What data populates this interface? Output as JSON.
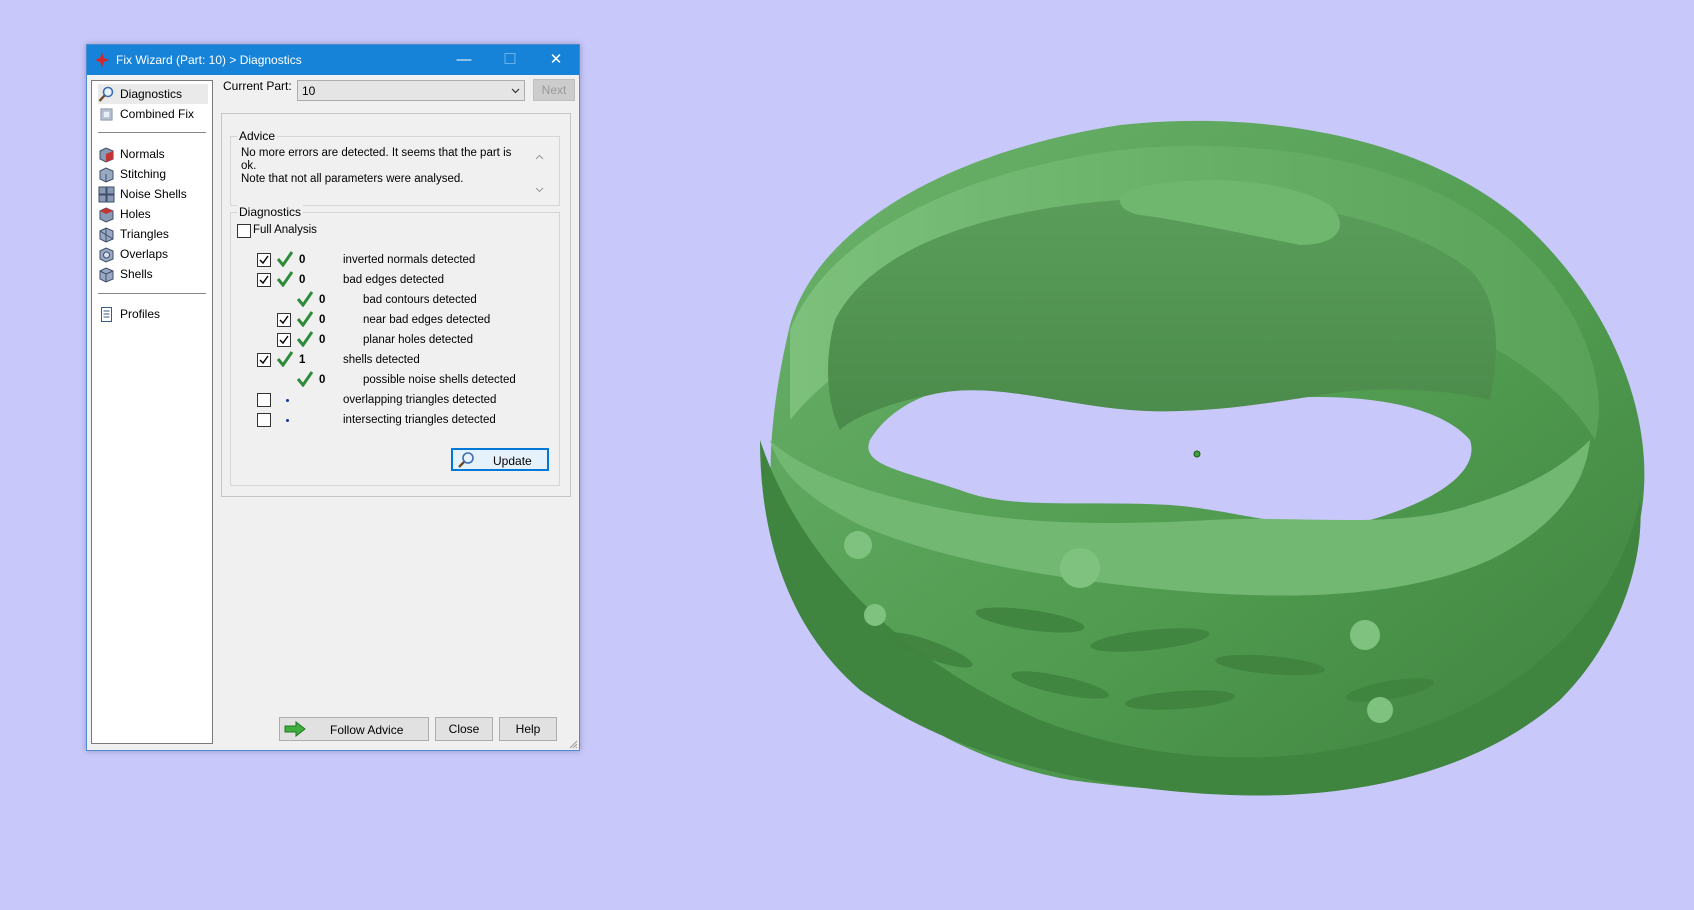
{
  "window": {
    "title": "Fix Wizard (Part: 10) > Diagnostics",
    "minimize": "—",
    "maximize": "☐",
    "close": "✕"
  },
  "sidebar": {
    "items": [
      {
        "label": "Diagnostics",
        "icon": "magnifier-icon",
        "selected": true
      },
      {
        "label": "Combined Fix",
        "icon": "combined-fix-icon"
      },
      {
        "label": "Normals",
        "icon": "normals-cube-icon"
      },
      {
        "label": "Stitching",
        "icon": "stitching-cube-icon"
      },
      {
        "label": "Noise Shells",
        "icon": "noise-shells-cube-icon"
      },
      {
        "label": "Holes",
        "icon": "holes-cube-icon"
      },
      {
        "label": "Triangles",
        "icon": "triangles-cube-icon"
      },
      {
        "label": "Overlaps",
        "icon": "overlaps-cube-icon"
      },
      {
        "label": "Shells",
        "icon": "shells-cube-icon"
      },
      {
        "label": "Profiles",
        "icon": "profile-document-icon"
      }
    ]
  },
  "current_part": {
    "label": "Current Part:",
    "value": "10",
    "next_label": "Next"
  },
  "advice": {
    "title": "Advice",
    "text_line1": "No more errors are detected. It seems that the part is ok.",
    "text_line2": "Note that not all parameters were analysed."
  },
  "diagnostics": {
    "title": "Diagnostics",
    "full_analysis_label": "Full Analysis",
    "full_analysis_checked": false,
    "rows": [
      {
        "checked": true,
        "status": "ok",
        "count": "0",
        "text": "inverted normals detected"
      },
      {
        "checked": true,
        "status": "ok",
        "count": "0",
        "text": "bad edges detected"
      },
      {
        "checked": null,
        "status": "ok",
        "count": "0",
        "text": "bad contours detected"
      },
      {
        "checked": true,
        "status": "ok",
        "count": "0",
        "text": "near bad edges detected"
      },
      {
        "checked": true,
        "status": "ok",
        "count": "0",
        "text": "planar holes detected"
      },
      {
        "checked": true,
        "status": "ok",
        "count": "1",
        "text": "shells detected"
      },
      {
        "checked": null,
        "status": "ok",
        "count": "0",
        "text": "possible noise shells detected"
      },
      {
        "checked": false,
        "status": "not-analysed",
        "count": "",
        "text": "overlapping triangles detected"
      },
      {
        "checked": false,
        "status": "not-analysed",
        "count": "",
        "text": "intersecting triangles detected"
      }
    ],
    "update_label": "Update"
  },
  "footer": {
    "follow_advice_label": "Follow Advice",
    "close_label": "Close",
    "help_label": "Help"
  },
  "colors": {
    "viewport_background": "#c8c8fb",
    "model_green": "#5fa05f",
    "titlebar_blue": "#1683d8",
    "check_green": "#2e8b3a"
  }
}
